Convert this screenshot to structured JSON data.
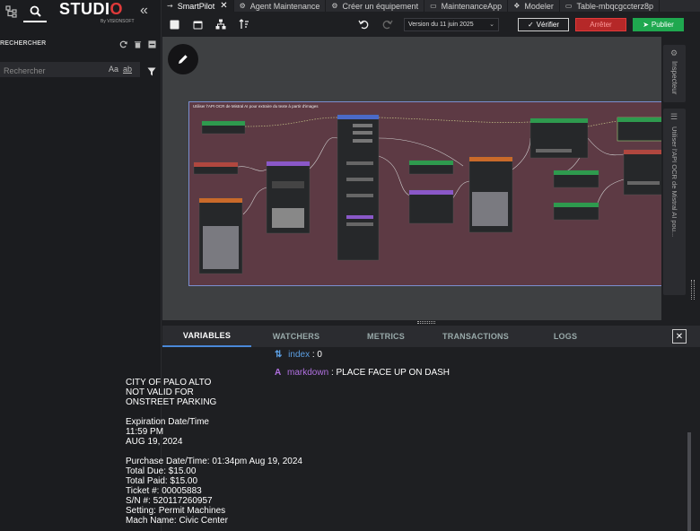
{
  "sidebar": {
    "logo": "STUDI",
    "logo_o": "O",
    "logo_sub": "By VISIONSOFT",
    "section_title": "RECHERCHER",
    "search_placeholder": "Rechercher",
    "opt_case": "Aa",
    "opt_word": "ab"
  },
  "tabs": [
    {
      "label": "SmartPilot",
      "active": true,
      "icon": "flow-icon"
    },
    {
      "label": "Agent Maintenance",
      "icon": "gear-icon"
    },
    {
      "label": "Créer un équipement",
      "icon": "gear-icon"
    },
    {
      "label": "MaintenanceApp",
      "icon": "window-icon"
    },
    {
      "label": "Modeler",
      "icon": "cubes-icon"
    },
    {
      "label": "Table-mbqcgccterz8p",
      "icon": "window-icon"
    }
  ],
  "toolbar": {
    "version": "Version du 11 juin 2025",
    "verify": "Vérifier",
    "stop": "Arrêter",
    "publish": "Publier"
  },
  "flow": {
    "title": "Utiliser l'API OCR de Mistral AI pour extraire du texte à partir d'images"
  },
  "right_rail": {
    "inspector": "Inspecteur",
    "node_title": "Utiliser l'API OCR de Mistral AI pou..."
  },
  "bottom_tabs": [
    "VARIABLES",
    "WATCHERS",
    "METRICS",
    "TRANSACTIONS",
    "LOGS"
  ],
  "variables": {
    "index_name": "index",
    "index_value": ": 0",
    "markdown_name": "markdown",
    "markdown_first": ": PLACE FACE UP ON DASH",
    "markdown_rest": "CITY OF PALO ALTO\nNOT VALID FOR\nONSTREET PARKING\n\nExpiration Date/Time\n11:59 PM\nAUG 19, 2024\n\nPurchase Date/Time: 01:34pm Aug 19, 2024\nTotal Due: $15.00\nTotal Paid: $15.00\nTicket #: 00005883\nS/N #: 520117260957\nSetting: Permit Machines\nMach Name: Civic Center"
  },
  "colors": {
    "accent": "#4a88d8",
    "danger": "#b52828",
    "success": "#1fa84f",
    "flow_bg": "#5d3a44",
    "markdown_name": "#b070e0",
    "index_name": "#5c9fe3"
  }
}
